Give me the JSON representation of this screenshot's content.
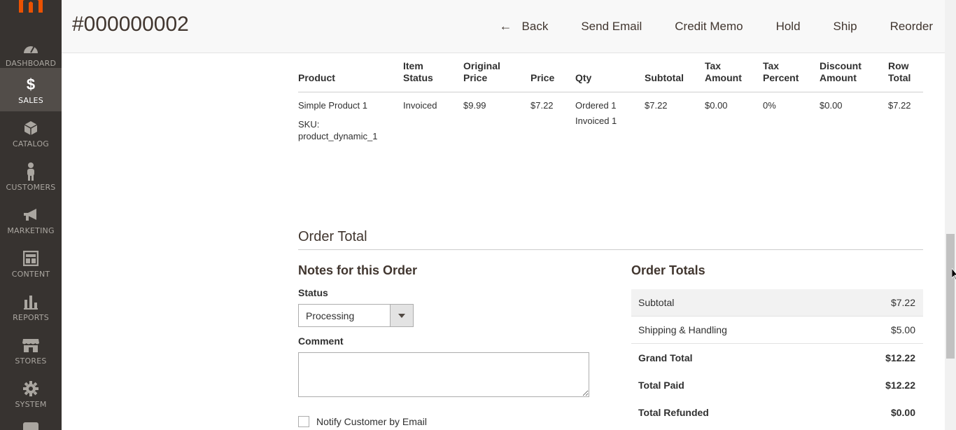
{
  "sidebar": {
    "items": [
      {
        "label": "DASHBOARD",
        "icon": "dashboard-icon"
      },
      {
        "label": "SALES",
        "icon": "dollar-icon",
        "active": true
      },
      {
        "label": "CATALOG",
        "icon": "cube-icon"
      },
      {
        "label": "CUSTOMERS",
        "icon": "person-icon"
      },
      {
        "label": "MARKETING",
        "icon": "megaphone-icon"
      },
      {
        "label": "CONTENT",
        "icon": "layout-icon"
      },
      {
        "label": "REPORTS",
        "icon": "bar-chart-icon"
      },
      {
        "label": "STORES",
        "icon": "store-icon"
      },
      {
        "label": "SYSTEM",
        "icon": "gear-icon"
      }
    ]
  },
  "header": {
    "title": "#000000002",
    "actions": {
      "back": "Back",
      "send_email": "Send Email",
      "credit_memo": "Credit Memo",
      "hold": "Hold",
      "ship": "Ship",
      "reorder": "Reorder"
    }
  },
  "items_table": {
    "headers": {
      "product": "Product",
      "item_status": [
        "Item",
        "Status"
      ],
      "original_price": [
        "Original",
        "Price"
      ],
      "price": "Price",
      "qty": "Qty",
      "subtotal": "Subtotal",
      "tax_amount": [
        "Tax",
        "Amount"
      ],
      "tax_percent": [
        "Tax",
        "Percent"
      ],
      "discount_amount": [
        "Discount",
        "Amount"
      ],
      "row_total": [
        "Row",
        "Total"
      ]
    },
    "row": {
      "product_name": "Simple Product 1",
      "sku_label": "SKU:",
      "sku_value": "product_dynamic_1",
      "item_status": "Invoiced",
      "original_price": "$9.99",
      "price": "$7.22",
      "qty_ordered": "Ordered 1",
      "qty_invoiced": "Invoiced 1",
      "subtotal": "$7.22",
      "tax_amount": "$0.00",
      "tax_percent": "0%",
      "discount_amount": "$0.00",
      "row_total": "$7.22"
    }
  },
  "order_total": {
    "section_title": "Order Total",
    "notes": {
      "title": "Notes for this Order",
      "status_label": "Status",
      "status_value": "Processing",
      "comment_label": "Comment",
      "comment_value": "",
      "notify_label": "Notify Customer by Email"
    },
    "totals": {
      "title": "Order Totals",
      "subtotal_label": "Subtotal",
      "subtotal_value": "$7.22",
      "shipping_label": "Shipping & Handling",
      "shipping_value": "$5.00",
      "grand_total_label": "Grand Total",
      "grand_total_value": "$12.22",
      "total_paid_label": "Total Paid",
      "total_paid_value": "$12.22",
      "total_refunded_label": "Total Refunded",
      "total_refunded_value": "$0.00"
    }
  },
  "colors": {
    "sidebar_bg": "#373330",
    "sidebar_active_bg": "#524d49",
    "logo_orange": "#eb5202",
    "header_bg": "#f8f8f8"
  }
}
